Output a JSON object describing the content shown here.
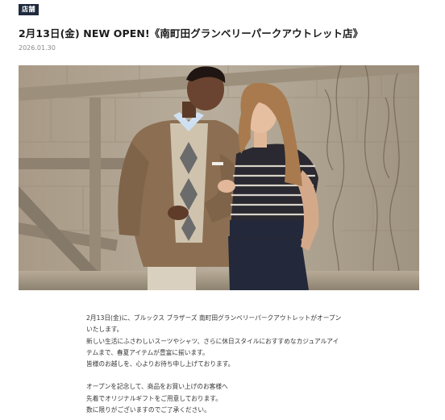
{
  "category_badge": "店舗",
  "article": {
    "title": "2月13日(金) NEW OPEN!《南町田グランベリーパークアウトレット店》",
    "date": "2026.01.30",
    "paragraph1": [
      "2月13日(金)に、ブルックス ブラザーズ 南町田グランベリーパークアウトレットがオープン",
      "いたします。",
      "新しい生活にふさわしいスーツやシャツ、さらに休日スタイルにおすすめなカジュアルアイ",
      "テムまで、春夏アイテムが豊富に揃います。",
      "皆様のお越しを、心よりお待ち申し上げております。"
    ],
    "paragraph2": [
      "オープンを記念して、商品をお買い上げのお客様へ",
      "先着でオリジナルギフトをご用意しております。",
      "数に限りがございますのでご了承ください。"
    ]
  },
  "colors": {
    "badge_bg": "#1f2b3d",
    "stone_wall": "#b0a38f",
    "jacket": "#8c6f52",
    "navy": "#23283a"
  }
}
